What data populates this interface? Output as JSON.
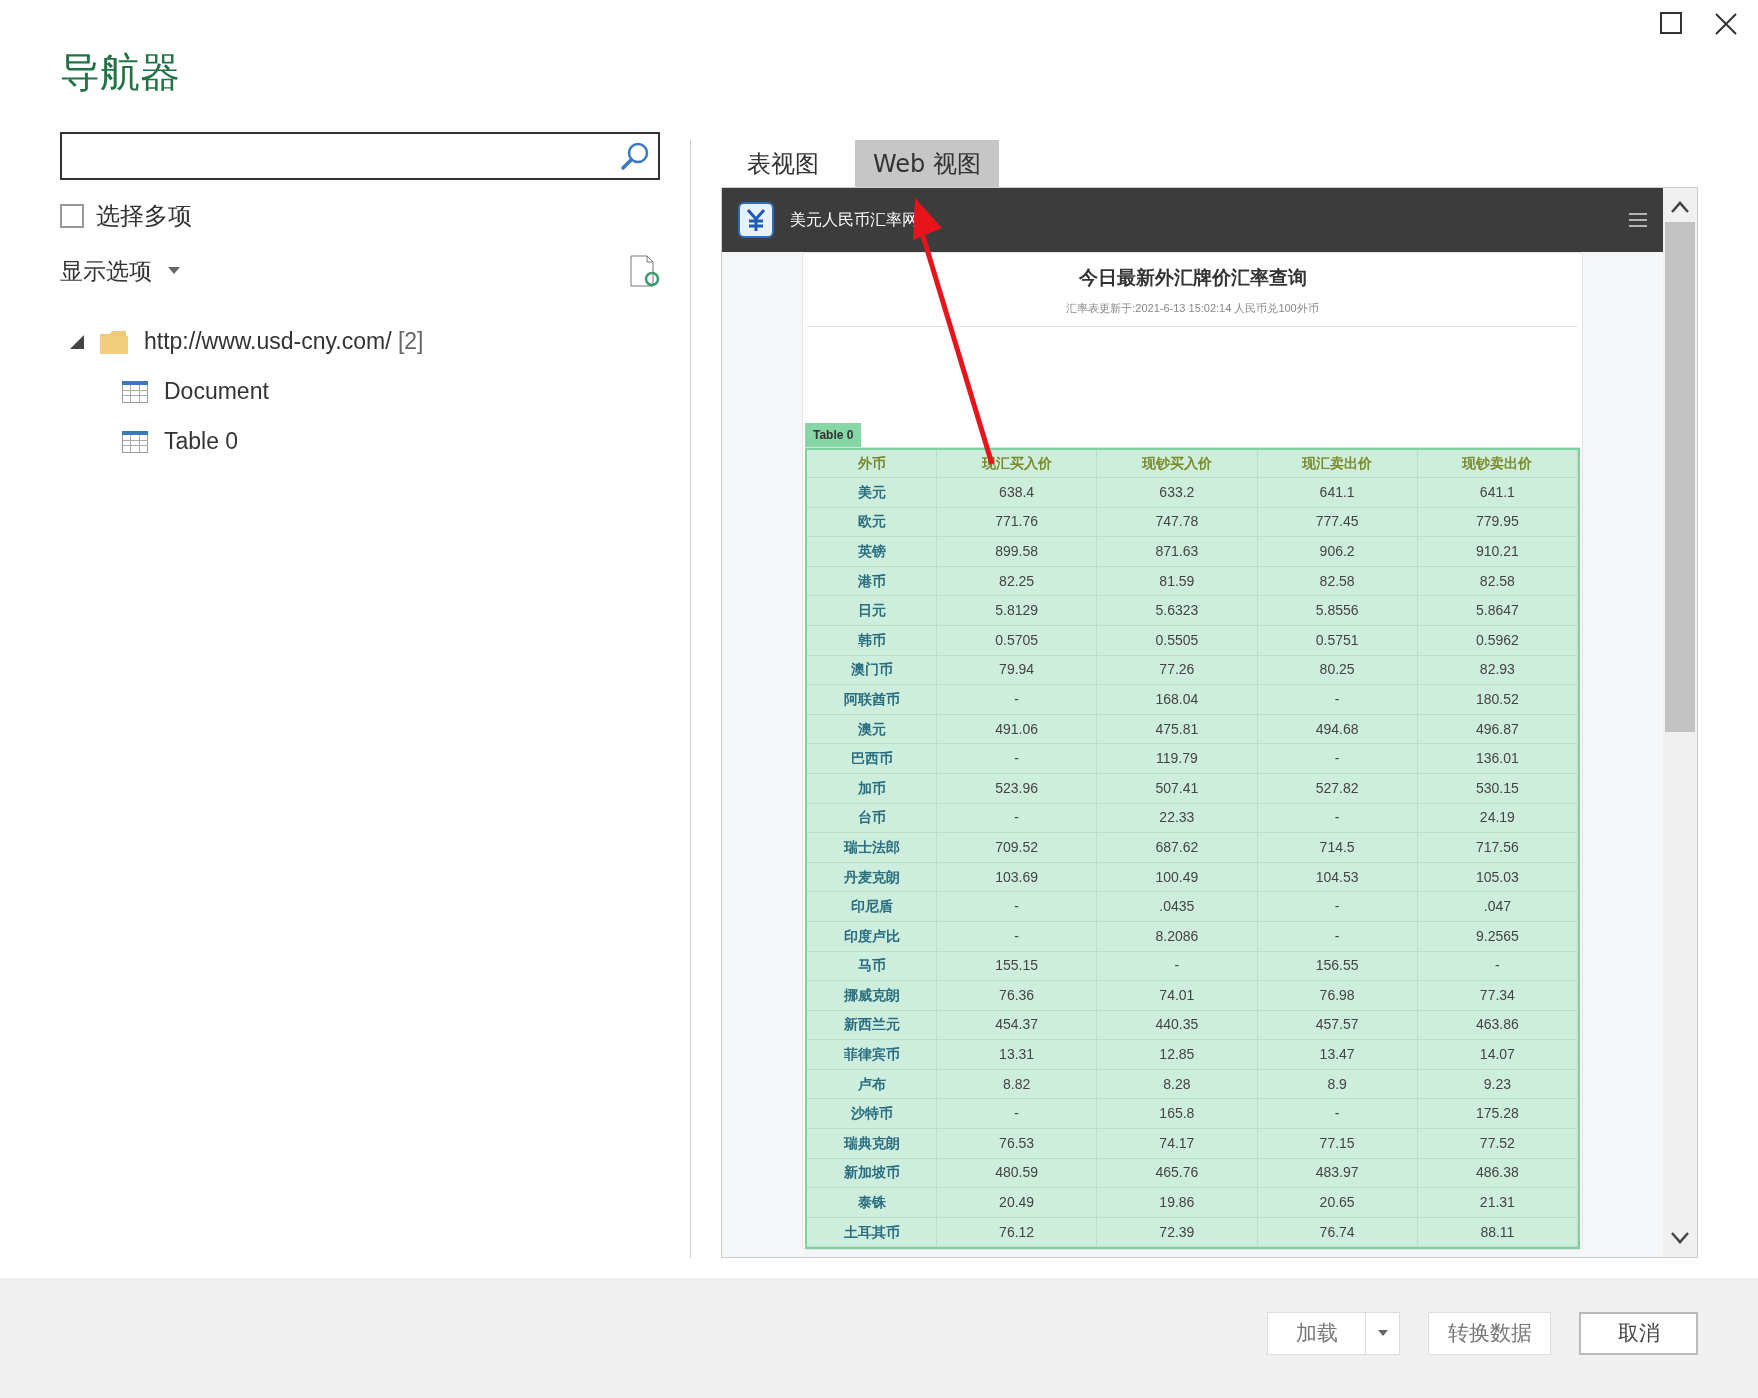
{
  "window": {
    "title": "导航器"
  },
  "multi_select": {
    "label": "选择多项",
    "checked": false
  },
  "display_options": {
    "label": "显示选项"
  },
  "tree": [
    {
      "label": "http://www.usd-cny.com/",
      "count": "[2]",
      "kind": "folder",
      "expanded": true,
      "selected": false,
      "children": [
        {
          "label": "Document",
          "kind": "table",
          "selected": false
        },
        {
          "label": "Table 0",
          "kind": "table",
          "selected": false
        }
      ]
    }
  ],
  "tabs": [
    {
      "label": "表视图",
      "selected": false
    },
    {
      "label": "Web 视图",
      "selected": true
    }
  ],
  "web_page": {
    "site_title": "美元人民币汇率网",
    "heading": "今日最新外汇牌价汇率查询",
    "subheading": "汇率表更新于:2021-6-13 15:02:14 人民币兑100外币",
    "table_tag": "Table 0",
    "columns": [
      "外币",
      "现汇买入价",
      "现钞买入价",
      "现汇卖出价",
      "现钞卖出价"
    ],
    "rows": [
      [
        "美元",
        "638.4",
        "633.2",
        "641.1",
        "641.1"
      ],
      [
        "欧元",
        "771.76",
        "747.78",
        "777.45",
        "779.95"
      ],
      [
        "英镑",
        "899.58",
        "871.63",
        "906.2",
        "910.21"
      ],
      [
        "港币",
        "82.25",
        "81.59",
        "82.58",
        "82.58"
      ],
      [
        "日元",
        "5.8129",
        "5.6323",
        "5.8556",
        "5.8647"
      ],
      [
        "韩币",
        "0.5705",
        "0.5505",
        "0.5751",
        "0.5962"
      ],
      [
        "澳门币",
        "79.94",
        "77.26",
        "80.25",
        "82.93"
      ],
      [
        "阿联酋币",
        "-",
        "168.04",
        "-",
        "180.52"
      ],
      [
        "澳元",
        "491.06",
        "475.81",
        "494.68",
        "496.87"
      ],
      [
        "巴西币",
        "-",
        "119.79",
        "-",
        "136.01"
      ],
      [
        "加币",
        "523.96",
        "507.41",
        "527.82",
        "530.15"
      ],
      [
        "台币",
        "-",
        "22.33",
        "-",
        "24.19"
      ],
      [
        "瑞士法郎",
        "709.52",
        "687.62",
        "714.5",
        "717.56"
      ],
      [
        "丹麦克朗",
        "103.69",
        "100.49",
        "104.53",
        "105.03"
      ],
      [
        "印尼盾",
        "-",
        ".0435",
        "-",
        ".047"
      ],
      [
        "印度卢比",
        "-",
        "8.2086",
        "-",
        "9.2565"
      ],
      [
        "马币",
        "155.15",
        "-",
        "156.55",
        "-"
      ],
      [
        "挪威克朗",
        "76.36",
        "74.01",
        "76.98",
        "77.34"
      ],
      [
        "新西兰元",
        "454.37",
        "440.35",
        "457.57",
        "463.86"
      ],
      [
        "菲律宾币",
        "13.31",
        "12.85",
        "13.47",
        "14.07"
      ],
      [
        "卢布",
        "8.82",
        "8.28",
        "8.9",
        "9.23"
      ],
      [
        "沙特币",
        "-",
        "165.8",
        "-",
        "175.28"
      ],
      [
        "瑞典克朗",
        "76.53",
        "74.17",
        "77.15",
        "77.52"
      ],
      [
        "新加坡币",
        "480.59",
        "465.76",
        "483.97",
        "486.38"
      ],
      [
        "泰铢",
        "20.49",
        "19.86",
        "20.65",
        "21.31"
      ],
      [
        "土耳其币",
        "76.12",
        "72.39",
        "76.74",
        "88.11"
      ]
    ]
  },
  "buttons": [
    {
      "label": "加载",
      "kind": "split"
    },
    {
      "label": "转换数据",
      "kind": "plain"
    },
    {
      "label": "取消",
      "kind": "outlined"
    }
  ]
}
